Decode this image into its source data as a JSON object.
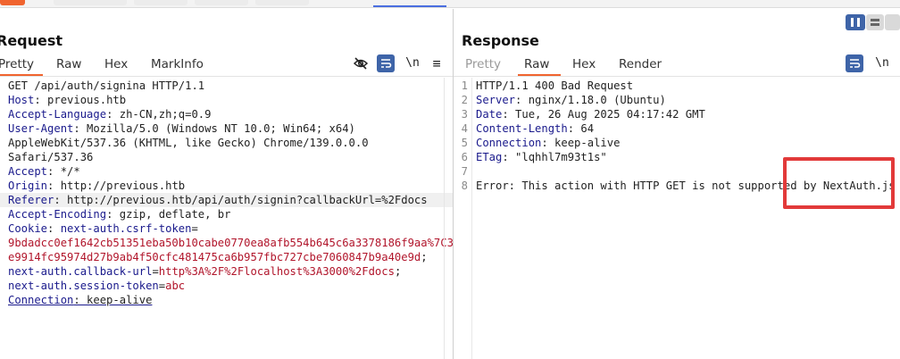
{
  "request": {
    "title": "Request",
    "tabs": [
      "Pretty",
      "Raw",
      "Hex",
      "MarkInfo"
    ],
    "icons": [
      "eye-off-icon",
      "wrap-icon",
      "newline-icon",
      "menu-icon"
    ],
    "newline_label": "\\n",
    "lines": [
      {
        "parts": [
          {
            "t": "GET /api/auth/signina HTTP/1.1",
            "c": "v"
          }
        ]
      },
      {
        "parts": [
          {
            "t": "Host",
            "c": "k"
          },
          {
            "t": ": previous.htb",
            "c": "v"
          }
        ]
      },
      {
        "parts": [
          {
            "t": "Accept-Language",
            "c": "k"
          },
          {
            "t": ": zh-CN,zh;q=0.9",
            "c": "v"
          }
        ]
      },
      {
        "parts": [
          {
            "t": "User-Agent",
            "c": "k"
          },
          {
            "t": ": Mozilla/5.0 (Windows NT 10.0; Win64; x64)",
            "c": "v"
          }
        ]
      },
      {
        "parts": [
          {
            "t": "AppleWebKit/537.36 (KHTML, like Gecko) Chrome/139.0.0.0",
            "c": "v"
          }
        ]
      },
      {
        "parts": [
          {
            "t": "Safari/537.36",
            "c": "v"
          }
        ]
      },
      {
        "parts": [
          {
            "t": "Accept",
            "c": "k"
          },
          {
            "t": ": */*",
            "c": "v"
          }
        ]
      },
      {
        "parts": [
          {
            "t": "Origin",
            "c": "k"
          },
          {
            "t": ": http://previous.htb",
            "c": "v"
          }
        ]
      },
      {
        "hl": true,
        "parts": [
          {
            "t": "Referer",
            "c": "k"
          },
          {
            "t": ": http://previous.htb/api/auth/signin?callbackUrl=%2Fdocs",
            "c": "v"
          }
        ]
      },
      {
        "parts": [
          {
            "t": "Accept-Encoding",
            "c": "k"
          },
          {
            "t": ": gzip, deflate, br",
            "c": "v"
          }
        ]
      },
      {
        "parts": [
          {
            "t": "Cookie",
            "c": "k"
          },
          {
            "t": ": ",
            "c": "v"
          },
          {
            "t": "next-auth.csrf-token",
            "c": "k"
          },
          {
            "t": "=",
            "c": "v"
          }
        ]
      },
      {
        "parts": [
          {
            "t": "9bdadcc0ef1642cb51351eba50b10cabe0770ea8afb554b645c6a3378186f9aa%7C3",
            "c": "red"
          }
        ]
      },
      {
        "parts": [
          {
            "t": "e9914fc95974d27b9ab4f50cfc481475ca6b957fbc727cbe7060847b9a40e9d",
            "c": "red"
          },
          {
            "t": ";",
            "c": "v"
          }
        ]
      },
      {
        "parts": [
          {
            "t": "next-auth.callback-url",
            "c": "k"
          },
          {
            "t": "=",
            "c": "v"
          },
          {
            "t": "http%3A%2F%2Flocalhost%3A3000%2Fdocs",
            "c": "red"
          },
          {
            "t": ";",
            "c": "v"
          }
        ]
      },
      {
        "parts": [
          {
            "t": "next-auth.session-token",
            "c": "k"
          },
          {
            "t": "=",
            "c": "v"
          },
          {
            "t": "abc",
            "c": "red"
          }
        ]
      },
      {
        "parts": [
          {
            "t": "Connection",
            "c": "k u"
          },
          {
            "t": ": keep-alive",
            "c": "v u"
          }
        ]
      }
    ]
  },
  "response": {
    "title": "Response",
    "tabs": [
      "Pretty",
      "Raw",
      "Hex",
      "Render"
    ],
    "icons": [
      "wrap-icon",
      "newline-icon"
    ],
    "newline_label": "\\n",
    "lines": [
      {
        "n": "1",
        "parts": [
          {
            "t": "HTTP/1.1 400 Bad Request",
            "c": "v"
          }
        ]
      },
      {
        "n": "2",
        "parts": [
          {
            "t": "Server",
            "c": "k"
          },
          {
            "t": ": nginx/1.18.0 (Ubuntu)",
            "c": "v"
          }
        ]
      },
      {
        "n": "3",
        "parts": [
          {
            "t": "Date",
            "c": "k"
          },
          {
            "t": ": Tue, 26 Aug 2025 04:17:42 GMT",
            "c": "v"
          }
        ]
      },
      {
        "n": "4",
        "parts": [
          {
            "t": "Content-Length",
            "c": "k"
          },
          {
            "t": ": 64",
            "c": "v"
          }
        ]
      },
      {
        "n": "5",
        "parts": [
          {
            "t": "Connection",
            "c": "k"
          },
          {
            "t": ": keep-alive",
            "c": "v"
          }
        ]
      },
      {
        "n": "6",
        "parts": [
          {
            "t": "ETag",
            "c": "k"
          },
          {
            "t": ": \"lqhhl7m93t1s\"",
            "c": "v"
          }
        ]
      },
      {
        "n": "7",
        "parts": []
      },
      {
        "n": "8",
        "parts": [
          {
            "t": "Error: This action with HTTP GET is not supported by NextAuth.js",
            "c": "v"
          }
        ]
      }
    ]
  },
  "colors": {
    "accent_tab": "#f0642f",
    "active_button": "#3e64a8",
    "annotation": "#e23a3a",
    "key": "#1a1a8c",
    "cookie_value": "#b1152b"
  }
}
